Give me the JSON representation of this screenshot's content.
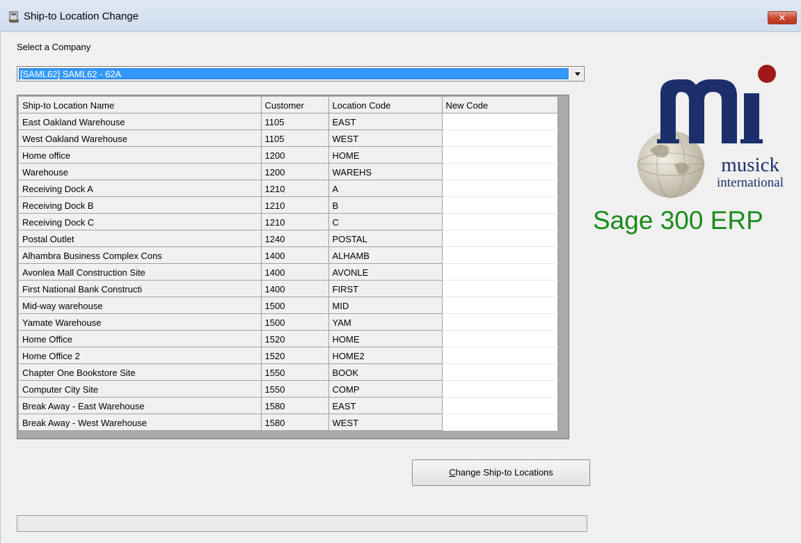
{
  "window": {
    "title": "Ship-to Location Change",
    "title_icon": "app-icon",
    "close_glyph": "✕"
  },
  "company": {
    "label": "Select a Company",
    "selected": "[SAML62] SAML62 - 62A"
  },
  "grid": {
    "columns": [
      "Ship-to Location Name",
      "Customer",
      "Location Code",
      "New Code"
    ],
    "rows": [
      [
        "East Oakland Warehouse",
        "1105",
        "EAST",
        ""
      ],
      [
        "West Oakland Warehouse",
        "1105",
        "WEST",
        ""
      ],
      [
        "Home office",
        "1200",
        "HOME",
        ""
      ],
      [
        "Warehouse",
        "1200",
        "WAREHS",
        ""
      ],
      [
        "Receiving Dock A",
        "1210",
        "A",
        ""
      ],
      [
        "Receiving Dock B",
        "1210",
        "B",
        ""
      ],
      [
        "Receiving Dock C",
        "1210",
        "C",
        ""
      ],
      [
        "Postal Outlet",
        "1240",
        "POSTAL",
        ""
      ],
      [
        "Alhambra Business Complex Cons",
        "1400",
        "ALHAMB",
        ""
      ],
      [
        "Avonlea Mall Construction Site",
        "1400",
        "AVONLE",
        ""
      ],
      [
        "First National Bank Constructi",
        "1400",
        "FIRST",
        ""
      ],
      [
        "Mid-way warehouse",
        "1500",
        "MID",
        ""
      ],
      [
        "Yamate Warehouse",
        "1500",
        "YAM",
        ""
      ],
      [
        "Home Office",
        "1520",
        "HOME",
        ""
      ],
      [
        "Home Office 2",
        "1520",
        "HOME2",
        ""
      ],
      [
        "Chapter One Bookstore Site",
        "1550",
        "BOOK",
        ""
      ],
      [
        "Computer City Site",
        "1550",
        "COMP",
        ""
      ],
      [
        "Break Away - East Warehouse",
        "1580",
        "EAST",
        ""
      ],
      [
        "Break Away - West Warehouse",
        "1580",
        "WEST",
        ""
      ]
    ]
  },
  "actions": {
    "change_button_mnemonic": "C",
    "change_button_rest": "hange Ship-to Locations"
  },
  "progress": {
    "value": 0
  },
  "branding": {
    "logo_word1": "musick",
    "logo_word2": "international",
    "product": "Sage 300 ERP",
    "product_color": "#1a8a1a",
    "logo_color": "#1c2f6b",
    "dot_color": "#a01818"
  }
}
